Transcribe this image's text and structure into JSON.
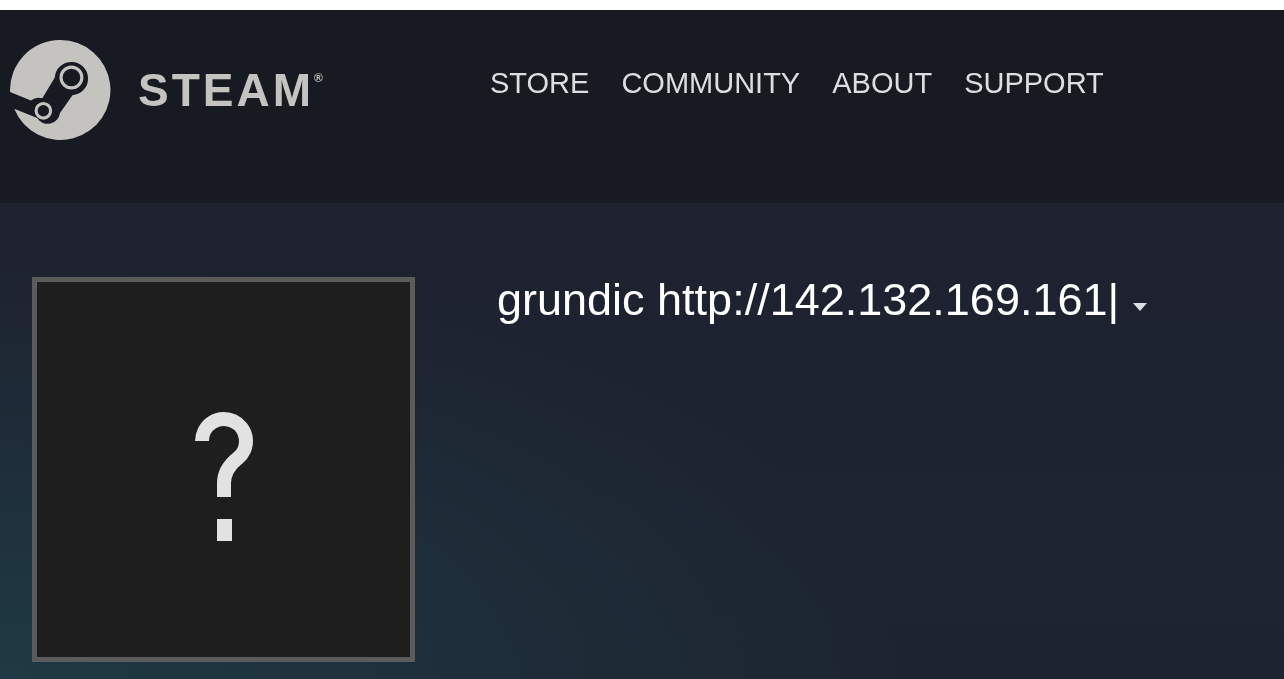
{
  "header": {
    "wordmark": "STEAM$^{®}$",
    "nav": [
      {
        "label": "STORE"
      },
      {
        "label": "COMMUNITY"
      },
      {
        "label": "ABOUT"
      },
      {
        "label": "SUPPORT"
      }
    ]
  },
  "profile": {
    "name": "grundic http://142.132.169.161|"
  }
}
